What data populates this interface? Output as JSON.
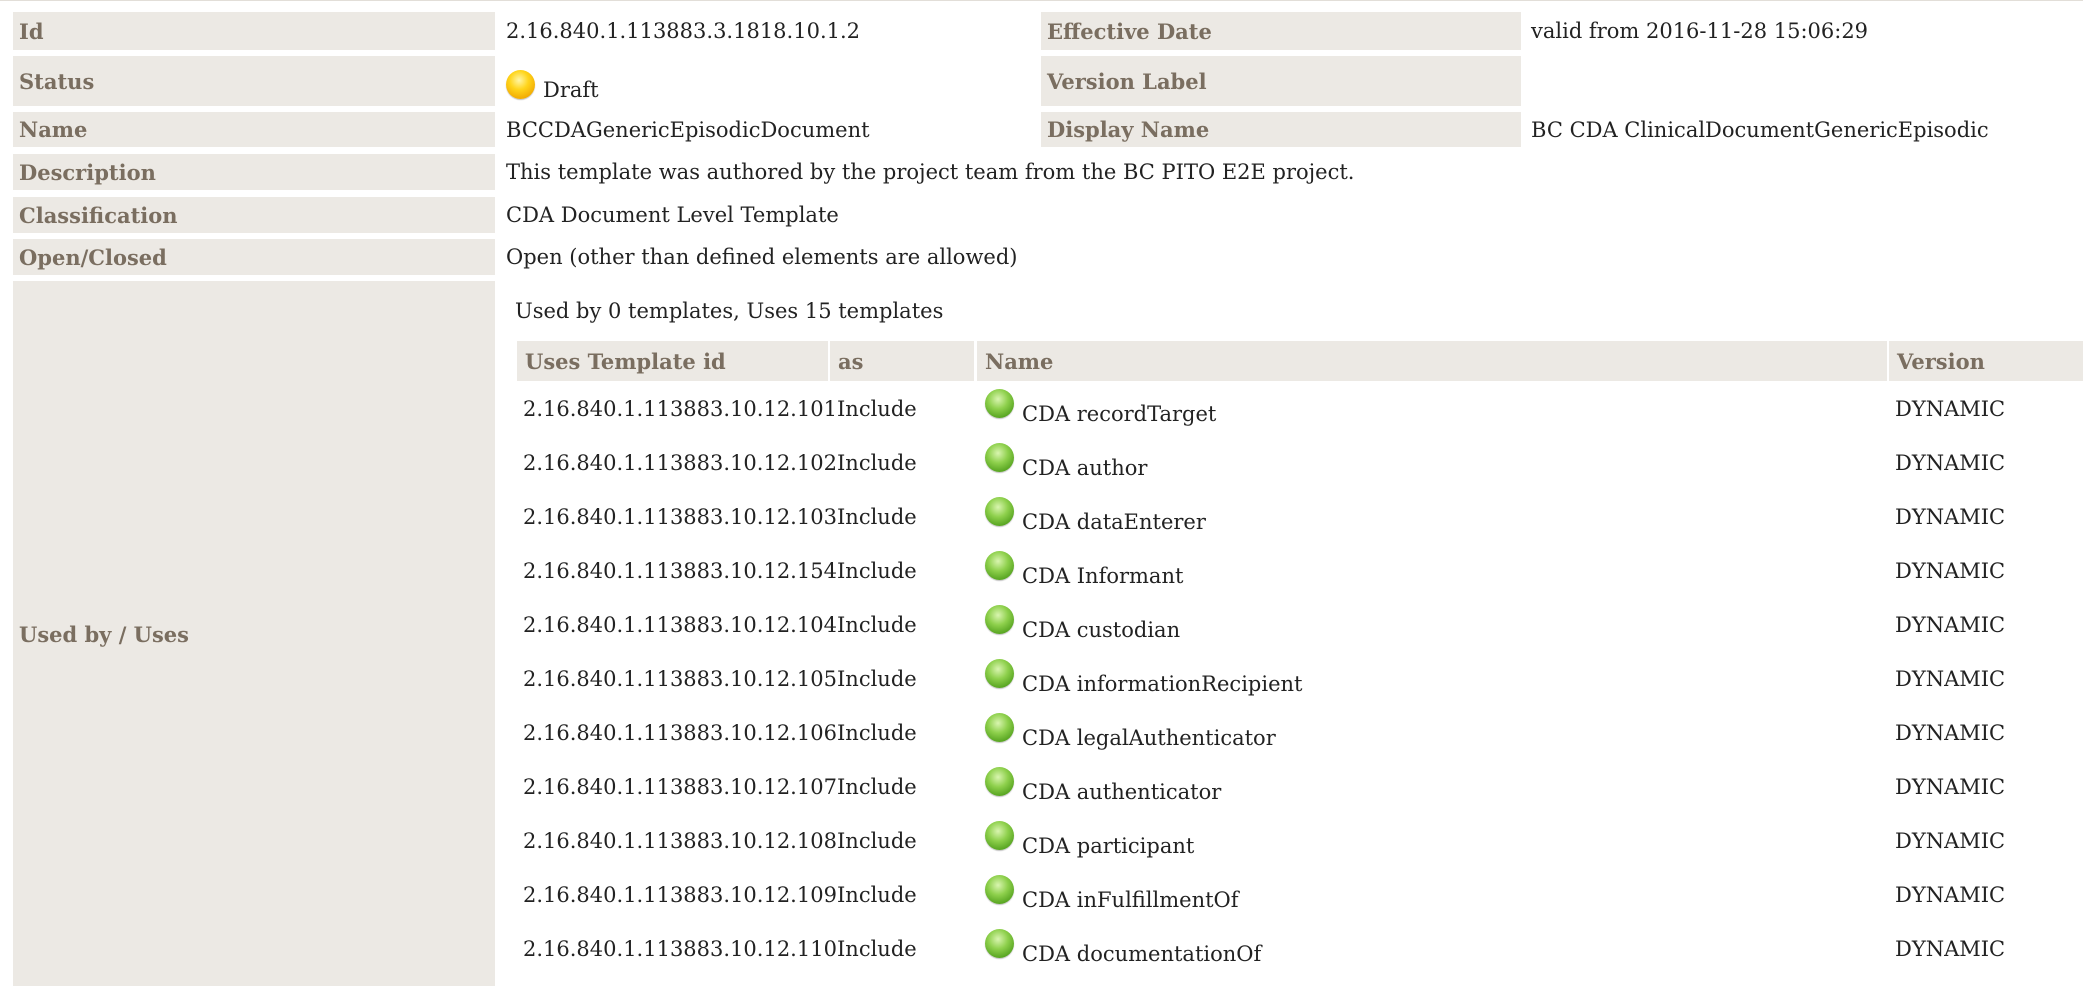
{
  "fields": {
    "id": {
      "label": "Id",
      "value": "2.16.840.1.113883.3.1818.10.1.2"
    },
    "effective_date": {
      "label": "Effective Date",
      "value": "valid from 2016-11-28 15:06:29"
    },
    "status": {
      "label": "Status",
      "value": "Draft",
      "indicator_color": "#f5c400"
    },
    "version_label": {
      "label": "Version Label",
      "value": ""
    },
    "name": {
      "label": "Name",
      "value": "BCCDAGenericEpisodicDocument"
    },
    "display_name": {
      "label": "Display Name",
      "value": "BC CDA ClinicalDocumentGenericEpisodic"
    },
    "description": {
      "label": "Description",
      "value": "This template was authored by the project team from the BC PITO E2E project."
    },
    "classification": {
      "label": "Classification",
      "value": "CDA Document Level Template"
    },
    "open_closed": {
      "label": "Open/Closed",
      "value": "Open (other than defined elements are allowed)"
    },
    "used_by_uses": {
      "label": "Used by / Uses"
    }
  },
  "usage": {
    "summary": "Used by 0 templates, Uses 15 templates",
    "columns": [
      "Uses Template id",
      "as",
      "Name",
      "Version"
    ],
    "rows": [
      {
        "template_id": "2.16.840.1.113883.10.12.101",
        "as": "Include",
        "name": "CDA recordTarget",
        "version": "DYNAMIC",
        "status_color": "#6cbf2f"
      },
      {
        "template_id": "2.16.840.1.113883.10.12.102",
        "as": "Include",
        "name": "CDA author",
        "version": "DYNAMIC",
        "status_color": "#6cbf2f"
      },
      {
        "template_id": "2.16.840.1.113883.10.12.103",
        "as": "Include",
        "name": "CDA dataEnterer",
        "version": "DYNAMIC",
        "status_color": "#6cbf2f"
      },
      {
        "template_id": "2.16.840.1.113883.10.12.154",
        "as": "Include",
        "name": "CDA Informant",
        "version": "DYNAMIC",
        "status_color": "#6cbf2f"
      },
      {
        "template_id": "2.16.840.1.113883.10.12.104",
        "as": "Include",
        "name": "CDA custodian",
        "version": "DYNAMIC",
        "status_color": "#6cbf2f"
      },
      {
        "template_id": "2.16.840.1.113883.10.12.105",
        "as": "Include",
        "name": "CDA informationRecipient",
        "version": "DYNAMIC",
        "status_color": "#6cbf2f"
      },
      {
        "template_id": "2.16.840.1.113883.10.12.106",
        "as": "Include",
        "name": "CDA legalAuthenticator",
        "version": "DYNAMIC",
        "status_color": "#6cbf2f"
      },
      {
        "template_id": "2.16.840.1.113883.10.12.107",
        "as": "Include",
        "name": "CDA authenticator",
        "version": "DYNAMIC",
        "status_color": "#6cbf2f"
      },
      {
        "template_id": "2.16.840.1.113883.10.12.108",
        "as": "Include",
        "name": "CDA participant",
        "version": "DYNAMIC",
        "status_color": "#6cbf2f"
      },
      {
        "template_id": "2.16.840.1.113883.10.12.109",
        "as": "Include",
        "name": "CDA inFulfillmentOf",
        "version": "DYNAMIC",
        "status_color": "#6cbf2f"
      },
      {
        "template_id": "2.16.840.1.113883.10.12.110",
        "as": "Include",
        "name": "CDA documentationOf",
        "version": "DYNAMIC",
        "status_color": "#6cbf2f"
      }
    ]
  },
  "colors": {
    "label_background": "#ece9e4",
    "label_text": "#7a6e60",
    "draft_indicator": "#f5c400",
    "active_indicator": "#6cbf2f"
  },
  "icons": {
    "status_draft": "yellow-status-dot-icon",
    "status_active": "green-status-dot-icon"
  }
}
